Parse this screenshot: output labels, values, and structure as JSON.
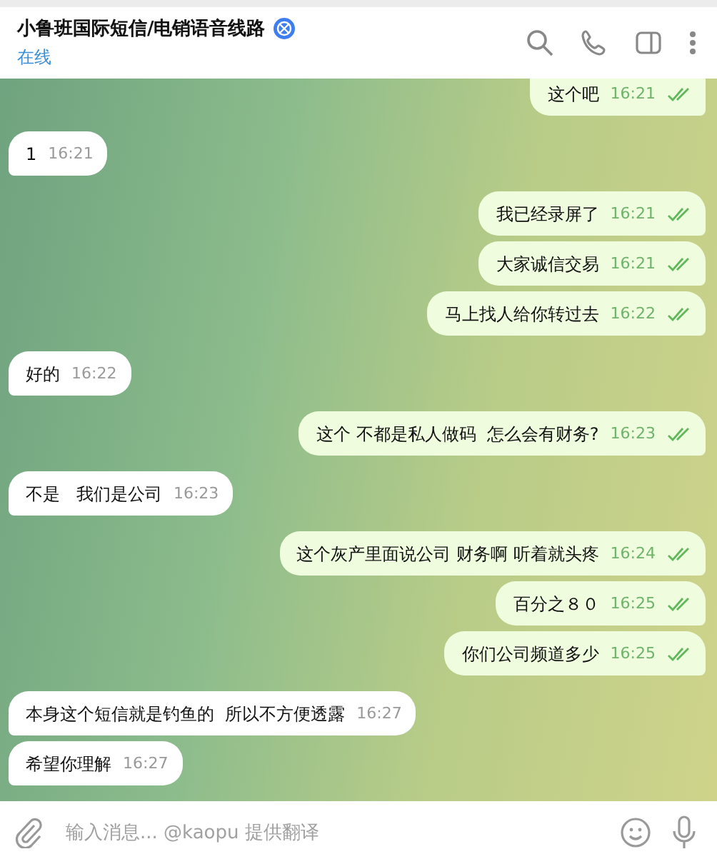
{
  "header": {
    "title": "小鲁班国际短信/电销语音线路",
    "status": "在线"
  },
  "messages": [
    {
      "kind": "outgoing",
      "text": "这个吧",
      "time": "16:21"
    },
    {
      "kind": "incoming",
      "text": "1",
      "time": "16:21"
    },
    {
      "kind": "outgoing",
      "text": "我已经录屏了",
      "time": "16:21"
    },
    {
      "kind": "outgoing",
      "text": "大家诚信交易",
      "time": "16:21"
    },
    {
      "kind": "outgoing",
      "text": "马上找人给你转过去",
      "time": "16:22"
    },
    {
      "kind": "incoming",
      "text": "好的",
      "time": "16:22"
    },
    {
      "kind": "outgoing",
      "text": "这个 不都是私人做码  怎么会有财务?",
      "time": "16:23"
    },
    {
      "kind": "incoming",
      "text": "不是   我们是公司",
      "time": "16:23"
    },
    {
      "kind": "outgoing",
      "text": "这个灰产里面说公司 财务啊 听着就头疼",
      "time": "16:24"
    },
    {
      "kind": "outgoing",
      "text": "百分之８０",
      "time": "16:25"
    },
    {
      "kind": "outgoing",
      "text": "你们公司频道多少",
      "time": "16:25"
    },
    {
      "kind": "incoming",
      "text": "本身这个短信就是钓鱼的  所以不方便透露",
      "time": "16:27"
    },
    {
      "kind": "incoming",
      "text": "希望你理解",
      "time": "16:27"
    }
  ],
  "composer": {
    "placeholder": "输入消息... @kaopu 提供翻译"
  }
}
